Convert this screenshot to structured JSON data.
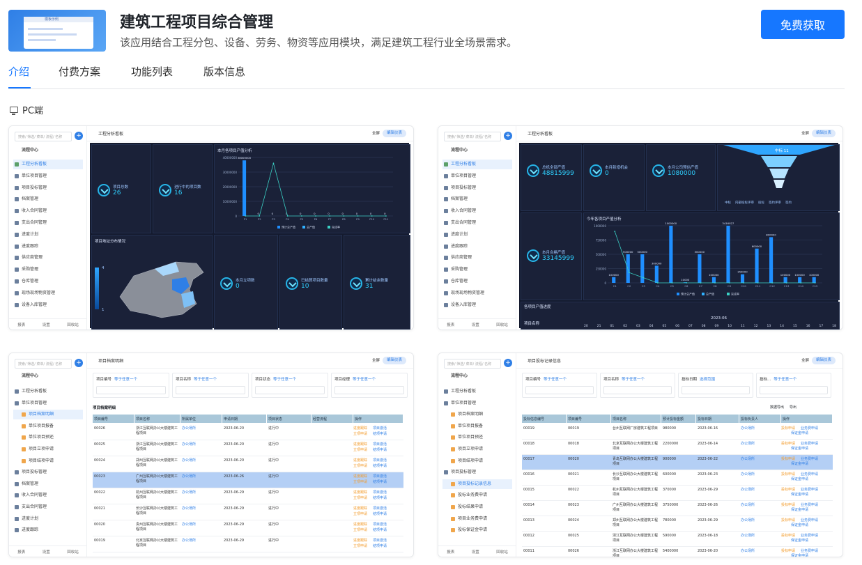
{
  "app": {
    "title": "建筑工程项目综合管理",
    "description": "该应用结合工程分包、设备、劳务、物资等应用模块，满足建筑工程行业全场景需求。",
    "cta_label": "免费获取",
    "icon_caption": "模板示例"
  },
  "tabs": [
    {
      "label": "介绍",
      "active": true
    },
    {
      "label": "付费方案",
      "active": false
    },
    {
      "label": "功能列表",
      "active": false
    },
    {
      "label": "版本信息",
      "active": false
    }
  ],
  "platform_label": "PC端",
  "colors": {
    "accent": "#1677ff",
    "dashboard_bg": "#141a2e",
    "highlight_row": "#b4cff5"
  },
  "common": {
    "search_placeholder": "搜索/ 筛选/ 菜单/ 流程/ 名称",
    "full_label": "全屏",
    "config_label": "编辑仪表",
    "footer": [
      "报表",
      "设置",
      "回收站"
    ],
    "flow_center": "流程中心"
  },
  "shot1": {
    "page_title": "工程分析看板",
    "menu": [
      "工程分析看板",
      "单位项目管理",
      "项目投标管理",
      "档案管理",
      "收入合同管理",
      "支出合同管理",
      "进度计划",
      "进度跟踪",
      "供应商管理",
      "采购管理",
      "仓库管理",
      "现场现场物资管理",
      "设备入库管理"
    ],
    "kpi": [
      {
        "label": "项目总数",
        "value": "26"
      },
      {
        "label": "进行中的项目数",
        "value": "16"
      },
      {
        "label": "本月立项数",
        "value": "0"
      },
      {
        "label": "已结算项目数量",
        "value": "10"
      },
      {
        "label": "累计结余数量",
        "value": "31"
      }
    ],
    "chart_title": "本月各项目产值分析",
    "map_title": "项目地址分布情况",
    "legend": [
      "预计总产值",
      "总产值",
      "完成率"
    ],
    "map_scale": [
      "4",
      "1"
    ]
  },
  "shot2": {
    "page_title": "工程分析看板",
    "kpi": [
      {
        "label": "总机全部产值",
        "value": "48815999"
      },
      {
        "label": "本月新增机会",
        "value": "0"
      },
      {
        "label": "本月公司预估产值",
        "value": "1080000"
      },
      {
        "label": "本月合格产值",
        "value": "33145999"
      }
    ],
    "chart_title": "今年各项目产值分析",
    "bottom_title": "各项目产值进度",
    "bottom_sub": "项目名称",
    "month": "2023-06",
    "days": [
      "20",
      "21",
      "01",
      "02",
      "03",
      "04",
      "05",
      "06",
      "07",
      "08",
      "09",
      "10",
      "11",
      "12",
      "13",
      "14",
      "15",
      "16",
      "17",
      "18"
    ],
    "funnel_top": "中标 11",
    "legend": [
      "中标",
      "内部投标评审",
      "投标",
      "签约评审",
      "签约"
    ]
  },
  "shot3": {
    "page_title": "项目档案明细",
    "filters": [
      {
        "label": "项目编号",
        "sel": "等于任意一个"
      },
      {
        "label": "项目名称",
        "sel": "等于任意一个"
      },
      {
        "label": "项目状态",
        "sel": "等于任意一个"
      },
      {
        "label": "项目经理",
        "sel": "等于任意一个"
      }
    ],
    "section": "项目档案明细",
    "columns": [
      "项目编号",
      "项目名称",
      "所属单位",
      "申请日期",
      "项目状态",
      "经营流程",
      "操作"
    ],
    "rows": [
      {
        "no": "00026",
        "name": "浙江互联网办公大楼建筑工程项目",
        "unit": "办公场所",
        "date": "2023-06-20",
        "status": "进行中",
        "ops": [
          "进度跟踪",
          "项目激活",
          "立项申请",
          "结项申请"
        ]
      },
      {
        "no": "00025",
        "name": "浙江互联网办公大楼建筑工程项目",
        "unit": "办公场所",
        "date": "2023-06-20",
        "status": "进行中",
        "ops": [
          "进度跟踪",
          "项目激活",
          "立项申请",
          "结项申请"
        ]
      },
      {
        "no": "00024",
        "name": "郑州互联网办公大楼建筑工程项目",
        "unit": "办公场所",
        "date": "2023-06-20",
        "status": "进行中",
        "ops": [
          "进度跟踪",
          "项目激活",
          "立项申请",
          "结项申请"
        ]
      },
      {
        "no": "00023",
        "name": "广州互联网办公大楼建筑工程项目",
        "unit": "办公场所",
        "date": "2023-06-26",
        "status": "进行中",
        "ops": [
          "进度跟踪",
          "项目激活",
          "立项申请",
          "结项申请"
        ]
      },
      {
        "no": "00022",
        "name": "杭州互联网办公大楼建筑工程项目",
        "unit": "办公场所",
        "date": "2023-06-29",
        "status": "进行中",
        "ops": [
          "进度跟踪",
          "项目激活",
          "立项申请",
          "结项申请"
        ]
      },
      {
        "no": "00021",
        "name": "长沙互联网办公大楼建筑工程项目",
        "unit": "办公场所",
        "date": "2023-06-29",
        "status": "进行中",
        "ops": [
          "进度跟踪",
          "项目激活",
          "立项申请",
          "结项申请"
        ]
      },
      {
        "no": "00020",
        "name": "贵州互联网办公大楼建筑工程项目",
        "unit": "办公场所",
        "date": "2023-06-29",
        "status": "进行中",
        "ops": [
          "进度跟踪",
          "项目激活",
          "立项申请",
          "结项申请"
        ]
      },
      {
        "no": "00019",
        "name": "北京互联网办公大楼建筑工程项目",
        "unit": "办公场所",
        "date": "2023-06-29",
        "status": "进行中",
        "ops": [
          "进度跟踪",
          "项目激活",
          "立项申请",
          "结项申请"
        ]
      }
    ],
    "menu": [
      {
        "label": "工程分析看板",
        "type": "chart"
      },
      {
        "label": "单位项目管理",
        "type": "folder"
      },
      {
        "label": "项目档案明细",
        "type": "sub",
        "active": true
      },
      {
        "label": "单位项目报备",
        "type": "sub"
      },
      {
        "label": "单位项目预还",
        "type": "sub"
      },
      {
        "label": "项目立项申请",
        "type": "sub"
      },
      {
        "label": "项目结项申请",
        "type": "sub"
      },
      {
        "label": "项目投标管理",
        "type": "folder"
      },
      {
        "label": "档案管理",
        "type": "folder"
      },
      {
        "label": "收入合同管理",
        "type": "folder"
      },
      {
        "label": "支出合同管理",
        "type": "folder"
      },
      {
        "label": "进度计划",
        "type": "folder"
      },
      {
        "label": "进度跟踪",
        "type": "folder"
      }
    ]
  },
  "shot4": {
    "page_title": "项目投标记录信息",
    "filters": [
      {
        "label": "项目编号",
        "sel": "等于任意一个"
      },
      {
        "label": "项目名称",
        "sel": "等于任意一个"
      },
      {
        "label": "投标日期",
        "sel": "选择范围"
      },
      {
        "label": "投标...",
        "sel": "等于任意一个"
      }
    ],
    "toolbar": [
      "数据导出",
      "导出"
    ],
    "columns": [
      "投标信息编号",
      "项目编号",
      "项目名称",
      "预计投标金额",
      "投标日期",
      "投标负责人",
      "操作"
    ],
    "rows": [
      {
        "a": "00019",
        "b": "00019",
        "name": "台州互联网厂房建筑工程项目",
        "amt": "980000",
        "date": "2023-06-16",
        "owner": "办公场所",
        "ops": [
          "投标申请",
          "业务费申请",
          "保证金申请"
        ]
      },
      {
        "a": "00018",
        "b": "00018",
        "name": "北京互联网办公大楼建筑工程项目",
        "amt": "2200000",
        "date": "2023-06-14",
        "owner": "办公场所",
        "ops": [
          "投标申请",
          "业务费申请",
          "保证金申请"
        ]
      },
      {
        "a": "00017",
        "b": "00020",
        "name": "青岛互联网办公大楼建筑工程项目",
        "amt": "900000",
        "date": "2023-06-22",
        "owner": "办公场所",
        "ops": [
          "投标申请",
          "业务费申请",
          "保证金申请"
        ]
      },
      {
        "a": "00016",
        "b": "00021",
        "name": "长沙互联网办公大楼建筑工程项目",
        "amt": "600000",
        "date": "2023-06-23",
        "owner": "办公场所",
        "ops": [
          "投标申请",
          "业务费申请",
          "保证金申请"
        ]
      },
      {
        "a": "00015",
        "b": "00022",
        "name": "杭州互联网办公大楼建筑工程项目",
        "amt": "370000",
        "date": "2023-06-29",
        "owner": "办公场所",
        "ops": [
          "投标申请",
          "业务费申请",
          "保证金申请"
        ]
      },
      {
        "a": "00014",
        "b": "00023",
        "name": "广州互联网办公大楼建筑工程项目",
        "amt": "3750000",
        "date": "2023-06-26",
        "owner": "办公场所",
        "ops": [
          "投标申请",
          "业务费申请",
          "保证金申请"
        ]
      },
      {
        "a": "00013",
        "b": "00024",
        "name": "郑州互联网办公大楼建筑工程项目",
        "amt": "780000",
        "date": "2023-06-29",
        "owner": "办公场所",
        "ops": [
          "投标申请",
          "业务费申请",
          "保证金申请"
        ]
      },
      {
        "a": "00012",
        "b": "00025",
        "name": "浙江互联网办公大楼建筑工程项目",
        "amt": "590000",
        "date": "2023-06-18",
        "owner": "办公场所",
        "ops": [
          "投标申请",
          "业务费申请",
          "保证金申请"
        ]
      },
      {
        "a": "00011",
        "b": "00026",
        "name": "浙江互联网办公大楼建筑工程项目",
        "amt": "5400000",
        "date": "2023-06-20",
        "owner": "办公场所",
        "ops": [
          "投标申请",
          "业务费申请",
          "保证金申请"
        ]
      }
    ],
    "menu": [
      {
        "label": "工程分析看板",
        "type": "chart"
      },
      {
        "label": "单位项目管理",
        "type": "folder"
      },
      {
        "label": "项目档案明细",
        "type": "sub"
      },
      {
        "label": "单位项目报备",
        "type": "sub"
      },
      {
        "label": "单位项目预还",
        "type": "sub"
      },
      {
        "label": "项目立项申请",
        "type": "sub"
      },
      {
        "label": "项目结项申请",
        "type": "sub"
      },
      {
        "label": "项目投标管理",
        "type": "folder"
      },
      {
        "label": "项目投标记录信息",
        "type": "sub",
        "active": true
      },
      {
        "label": "投标业务费申请",
        "type": "sub"
      },
      {
        "label": "投标结果申请",
        "type": "sub"
      },
      {
        "label": "项目业务费申请",
        "type": "sub"
      },
      {
        "label": "投标保证金申请",
        "type": "sub"
      }
    ]
  },
  "chart_data": [
    {
      "type": "bar",
      "title": "本月各项目产值分析",
      "categories": [
        "P1",
        "P2",
        "P3",
        "P4",
        "P5",
        "P6",
        "P7",
        "P8",
        "P9",
        "P10",
        "P11"
      ],
      "series": [
        {
          "name": "预计总产值",
          "values": [
            38000000,
            0,
            0,
            0,
            0,
            0,
            0,
            0,
            0,
            0,
            0
          ]
        },
        {
          "name": "总产值",
          "values": [
            0,
            0,
            0,
            0,
            0,
            0,
            0,
            0,
            0,
            0,
            0
          ]
        },
        {
          "name": "完成率",
          "values": [
            0,
            0,
            200,
            0,
            0,
            0,
            0,
            0,
            0,
            0,
            0
          ]
        }
      ],
      "ylim": [
        0,
        40000000
      ],
      "legend": "bottom"
    },
    {
      "type": "bar",
      "title": "今年各项目产值分析",
      "categories": [
        "C1",
        "C2",
        "C3",
        "C4",
        "C5",
        "C6",
        "C7",
        "C8",
        "C9",
        "C10",
        "C11",
        "C12",
        "C13",
        "C14",
        "C15"
      ],
      "series": [
        {
          "name": "预计总产值",
          "values": [
            100000,
            500000,
            500000,
            300000,
            1000000,
            10000,
            500000,
            100000,
            3416027,
            150000,
            600000,
            800000,
            100000,
            100000,
            100000
          ]
        },
        {
          "name": "总产值",
          "values": [
            0,
            0,
            0,
            0,
            0,
            0,
            0,
            0,
            0,
            0,
            0,
            0,
            0,
            0,
            0
          ]
        },
        {
          "name": "完成率",
          "values": [
            50,
            10,
            5,
            0,
            0,
            0,
            0,
            0,
            0,
            0,
            0,
            0,
            0,
            0,
            0
          ]
        }
      ],
      "ylim": [
        0,
        1000000
      ],
      "legend": "bottom"
    }
  ]
}
